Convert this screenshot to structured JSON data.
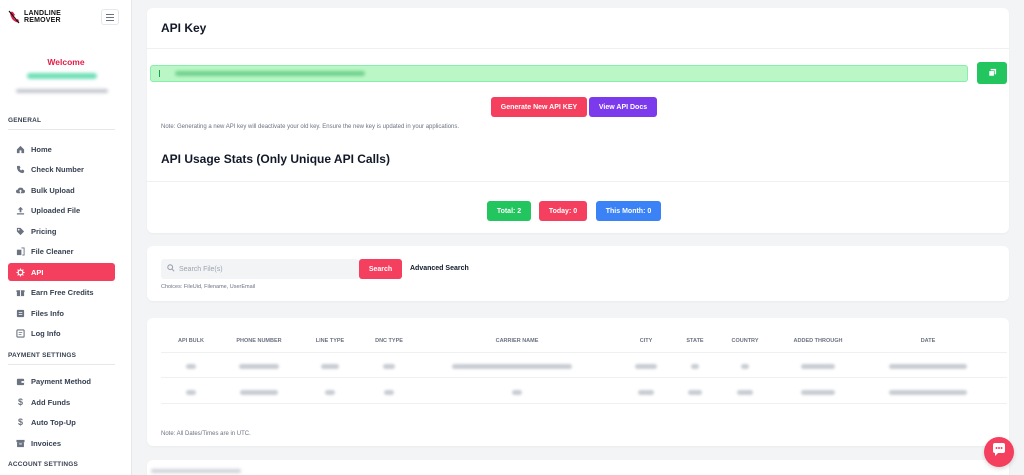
{
  "brand": {
    "line1": "LANDLINE",
    "line2": "REMOVER"
  },
  "sidebar": {
    "welcome": "Welcome",
    "sections": {
      "general": "GENERAL",
      "payment": "PAYMENT SETTINGS",
      "account": "ACCOUNT SETTINGS"
    },
    "general_items": [
      {
        "label": "Home",
        "icon": "home-icon"
      },
      {
        "label": "Check Number",
        "icon": "phone-icon"
      },
      {
        "label": "Bulk Upload",
        "icon": "cloud-upload-icon"
      },
      {
        "label": "Uploaded File",
        "icon": "upload-icon"
      },
      {
        "label": "Pricing",
        "icon": "tag-icon"
      },
      {
        "label": "File Cleaner",
        "icon": "file-cleaner-icon"
      },
      {
        "label": "API",
        "icon": "gear-icon",
        "active": true
      },
      {
        "label": "Earn Free Credits",
        "icon": "gift-icon"
      },
      {
        "label": "Files Info",
        "icon": "files-icon"
      },
      {
        "label": "Log Info",
        "icon": "log-icon"
      }
    ],
    "payment_items": [
      {
        "label": "Payment Method",
        "icon": "wallet-icon"
      },
      {
        "label": "Add Funds",
        "icon": "dollar-icon"
      },
      {
        "label": "Auto Top-Up",
        "icon": "dollar-icon"
      },
      {
        "label": "Invoices",
        "icon": "archive-icon"
      }
    ]
  },
  "api": {
    "title": "API Key",
    "generate_label": "Generate New API KEY",
    "docs_label": "View API Docs",
    "note": "Note: Generating a new API key will deactivate your old key. Ensure the new key is updated in your applications.",
    "stats_title": "API Usage Stats (Only Unique API Calls)",
    "stats": {
      "total": "Total: 2",
      "today": "Today: 0",
      "month": "This Month: 0"
    }
  },
  "search": {
    "placeholder": "Search File(s)",
    "button": "Search",
    "advanced": "Advanced Search",
    "hint": "Choices: FileUid, Filename, UserEmail"
  },
  "table": {
    "headers": [
      "API BULK",
      "PHONE NUMBER",
      "LINE TYPE",
      "DNC TYPE",
      "CARRIER NAME",
      "CITY",
      "STATE",
      "COUNTRY",
      "ADDED THROUGH",
      "DATE"
    ],
    "note": "Note: All Dates/Times are in UTC."
  },
  "colors": {
    "accent": "#f43f5e",
    "green": "#22c55e",
    "purple": "#7c3aed",
    "blue": "#3b82f6"
  }
}
